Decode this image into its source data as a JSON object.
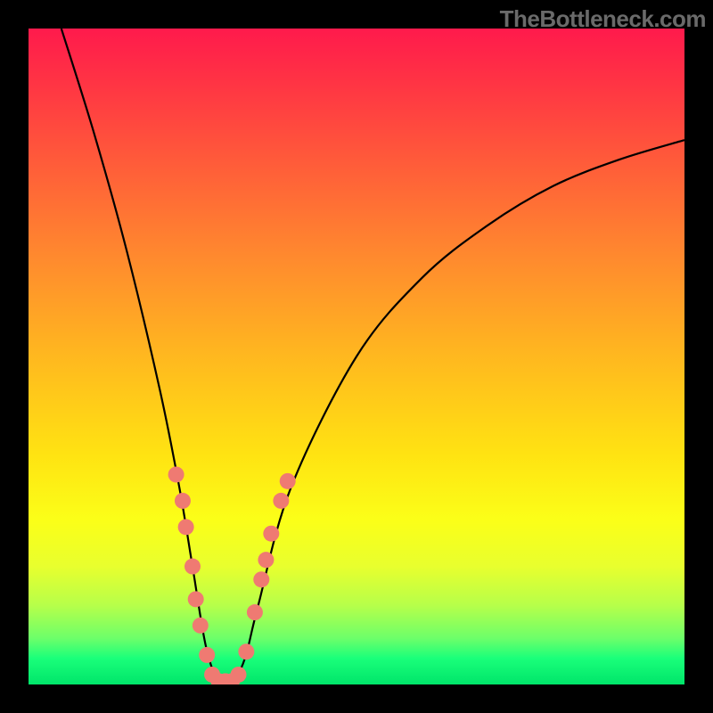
{
  "watermark": "TheBottleneck.com",
  "chart_data": {
    "type": "line",
    "title": "",
    "xlabel": "",
    "ylabel": "",
    "xlim": [
      0,
      100
    ],
    "ylim": [
      0,
      100
    ],
    "grid": false,
    "legend": null,
    "series": [
      {
        "name": "bottleneck-curve",
        "x": [
          5,
          10,
          15,
          20,
          23,
          25,
          27,
          29,
          30,
          31,
          33,
          35,
          40,
          50,
          60,
          70,
          80,
          90,
          100
        ],
        "y": [
          100,
          84,
          66,
          45,
          30,
          18,
          6,
          0,
          0,
          0,
          4,
          12,
          30,
          50,
          62,
          70,
          76,
          80,
          83
        ]
      }
    ],
    "markers": [
      {
        "x": 22.5,
        "y": 32
      },
      {
        "x": 23.5,
        "y": 28
      },
      {
        "x": 24.0,
        "y": 24
      },
      {
        "x": 25.0,
        "y": 18
      },
      {
        "x": 25.5,
        "y": 13
      },
      {
        "x": 26.2,
        "y": 9
      },
      {
        "x": 27.2,
        "y": 4.5
      },
      {
        "x": 28.0,
        "y": 1.5
      },
      {
        "x": 29.0,
        "y": 0.5
      },
      {
        "x": 30.0,
        "y": 0.5
      },
      {
        "x": 31.0,
        "y": 0.5
      },
      {
        "x": 32.0,
        "y": 1.5
      },
      {
        "x": 33.2,
        "y": 5
      },
      {
        "x": 34.5,
        "y": 11
      },
      {
        "x": 35.5,
        "y": 16
      },
      {
        "x": 36.2,
        "y": 19
      },
      {
        "x": 37.0,
        "y": 23
      },
      {
        "x": 38.5,
        "y": 28
      },
      {
        "x": 39.5,
        "y": 31
      }
    ],
    "marker_color": "#ef7a72",
    "curve_color": "#000000"
  }
}
